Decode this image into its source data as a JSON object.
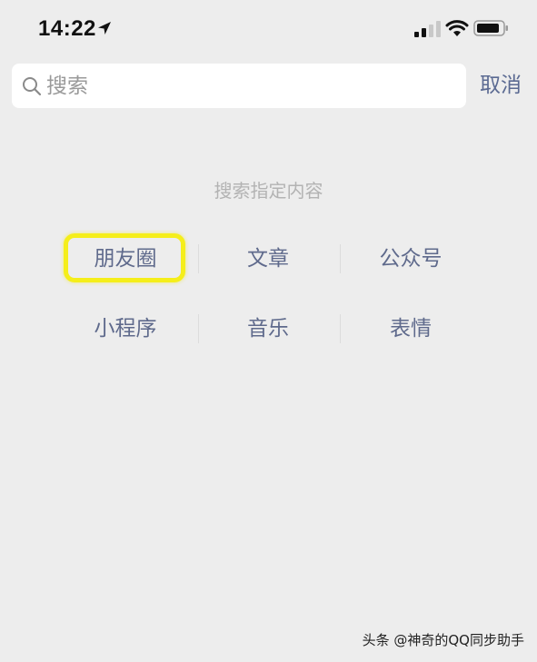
{
  "status_bar": {
    "time": "14:22"
  },
  "search": {
    "placeholder": "搜索",
    "value": ""
  },
  "cancel_label": "取消",
  "hint": "搜索指定内容",
  "categories": {
    "row1": [
      "朋友圈",
      "文章",
      "公众号"
    ],
    "row2": [
      "小程序",
      "音乐",
      "表情"
    ]
  },
  "highlight_color": "#f5ee1a",
  "accent_color": "#5f6a8c",
  "watermark": "头条 @神奇的QQ同步助手"
}
